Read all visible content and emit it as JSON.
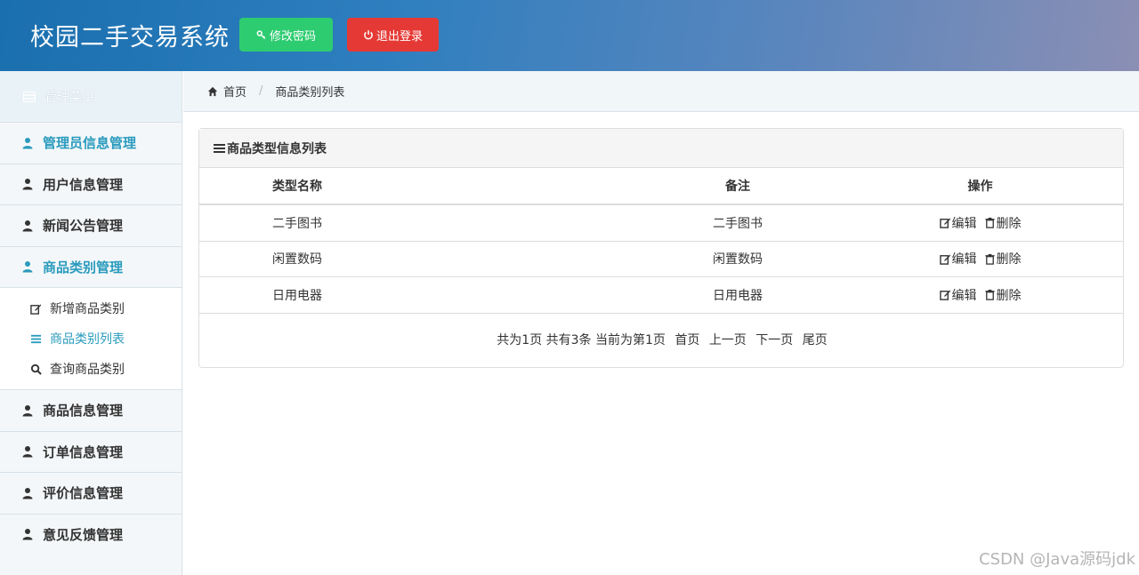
{
  "header": {
    "title": "校园二手交易系统",
    "change_password": "修改密码",
    "logout": "退出登录"
  },
  "sidebar": {
    "menu_title": "管理菜单",
    "items": [
      {
        "label": "管理员信息管理",
        "active": true
      },
      {
        "label": "用户信息管理"
      },
      {
        "label": "新闻公告管理"
      },
      {
        "label": "商品类别管理",
        "active": true
      }
    ],
    "sub_items": [
      {
        "label": "新增商品类别",
        "icon": "edit-icon"
      },
      {
        "label": "商品类别列表",
        "icon": "list-icon",
        "active": true
      },
      {
        "label": "查询商品类别",
        "icon": "search-icon"
      }
    ],
    "items_after": [
      {
        "label": "商品信息管理"
      },
      {
        "label": "订单信息管理"
      },
      {
        "label": "评价信息管理"
      },
      {
        "label": "意见反馈管理"
      }
    ]
  },
  "breadcrumb": {
    "home": "首页",
    "current": "商品类别列表"
  },
  "panel": {
    "title": "商品类型信息列表",
    "columns": [
      "类型名称",
      "备注",
      "操作"
    ],
    "rows": [
      {
        "name": "二手图书",
        "note": "二手图书"
      },
      {
        "name": "闲置数码",
        "note": "闲置数码"
      },
      {
        "name": "日用电器",
        "note": "日用电器"
      }
    ],
    "actions": {
      "edit": "编辑",
      "delete": "删除"
    },
    "pager": {
      "summary": "共为1页 共有3条 当前为第1页",
      "first": "首页",
      "prev": "上一页",
      "next": "下一页",
      "last": "尾页"
    }
  },
  "watermark": "CSDN @Java源码jdk",
  "colors": {
    "accent": "#2a9bbd",
    "green": "#2ecc71",
    "red": "#e53935"
  }
}
